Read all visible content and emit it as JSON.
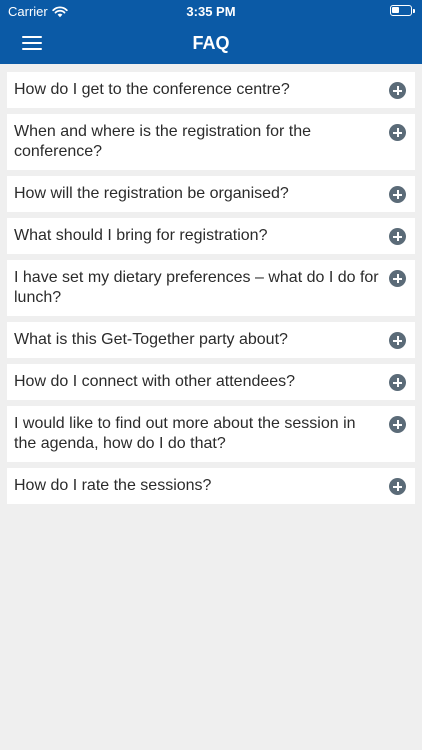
{
  "status_bar": {
    "carrier": "Carrier",
    "time": "3:35 PM"
  },
  "header": {
    "title": "FAQ",
    "menu_icon": "hamburger-menu-icon"
  },
  "colors": {
    "header": "#0b5aa6",
    "background": "#efefef",
    "card": "#ffffff",
    "expand_icon": "#5b6b78"
  },
  "faq": {
    "items": [
      {
        "question": "How do I get to the conference centre?"
      },
      {
        "question": "When and where is the registration for the conference?"
      },
      {
        "question": "How will the registration be organised?"
      },
      {
        "question": "What should I bring for registration?"
      },
      {
        "question": "I have set my dietary preferences – what do I do for lunch?"
      },
      {
        "question": "What is this Get-Together party about?"
      },
      {
        "question": "How do I connect with other attendees?"
      },
      {
        "question": "I would like to find out more about the session in the agenda, how do I do that?"
      },
      {
        "question": "How do I rate the sessions?"
      }
    ]
  }
}
